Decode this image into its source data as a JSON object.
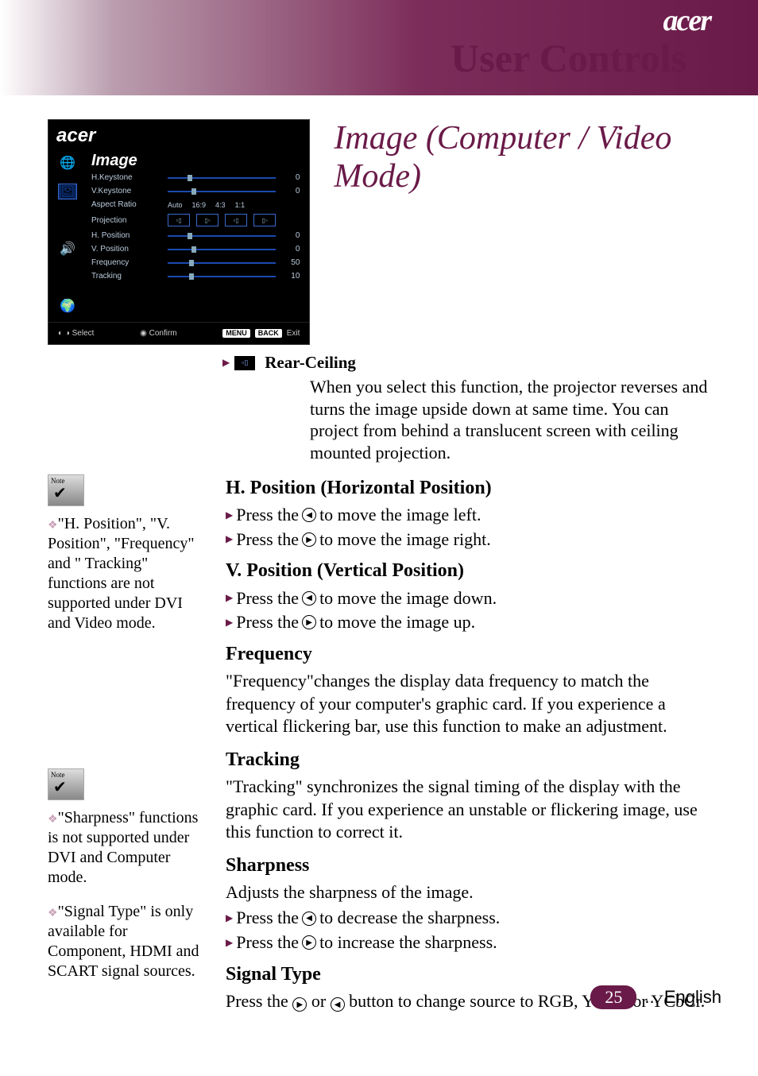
{
  "header": {
    "logo": "acer",
    "title": "User Controls"
  },
  "osd": {
    "logo": "acer",
    "title": "Image",
    "items": [
      {
        "label": "H.Keystone",
        "value": "0",
        "type": "slider"
      },
      {
        "label": "V.Keystone",
        "value": "0",
        "type": "slider"
      },
      {
        "label": "Aspect Ratio",
        "type": "options",
        "options": [
          "Auto",
          "16:9",
          "4:3",
          "1:1"
        ]
      },
      {
        "label": "Projection",
        "type": "projection"
      },
      {
        "label": "H. Position",
        "value": "0",
        "type": "slider"
      },
      {
        "label": "V. Position",
        "value": "0",
        "type": "slider"
      },
      {
        "label": "Frequency",
        "value": "50",
        "type": "slider"
      },
      {
        "label": "Tracking",
        "value": "10",
        "type": "slider"
      }
    ],
    "footer": {
      "select": "Select",
      "confirm": "Confirm",
      "menu": "MENU",
      "back": "BACK",
      "exit": "Exit"
    }
  },
  "section_title": "Image (Computer / Video Mode)",
  "rear_ceiling": {
    "name": "Rear-Ceiling",
    "desc": "When you select this function, the projector reverses and turns the image upside down at same time. You can project from behind a translucent screen with ceiling mounted projection."
  },
  "notes": {
    "n1": "\"H. Position\", \"V. Position\", \"Frequency\" and \" Tracking\" functions are not supported under DVI and Video mode.",
    "n2": "\"Sharpness\" functions is not supported under DVI and Computer mode.",
    "n3": "\"Signal Type\" is only available for Component, HDMI and SCART signal sources."
  },
  "content": {
    "hpos": {
      "title": "H. Position (Horizontal Position)",
      "b1a": "Press the ",
      "b1b": " to move the image left.",
      "b2a": "Press the ",
      "b2b": " to move the image right."
    },
    "vpos": {
      "title": "V. Position (Vertical Position)",
      "b1a": "Press the ",
      "b1b": " to move the image down.",
      "b2a": "Press the ",
      "b2b": " to move the image up."
    },
    "freq": {
      "title": "Frequency",
      "p": "\"Frequency\"changes the display data frequency to match the frequency of your computer's graphic card. If you experience a vertical flickering bar, use this function to make an adjustment."
    },
    "track": {
      "title": "Tracking",
      "p": "\"Tracking\" synchronizes the signal timing of the display with the graphic card. If you experience an unstable or flickering image, use this function to correct it."
    },
    "sharp": {
      "title": "Sharpness",
      "p": "Adjusts the sharpness of the image.",
      "b1a": "Press the ",
      "b1b": " to decrease the sharpness.",
      "b2a": "Press the ",
      "b2b": " to increase the sharpness."
    },
    "signal": {
      "title": "Signal Type",
      "pa": "Press the ",
      "pmid": " or ",
      "pb": " button to change source to RGB, YPbPr or YCbCr."
    }
  },
  "footer": {
    "page": "25",
    "lang": "... English"
  }
}
